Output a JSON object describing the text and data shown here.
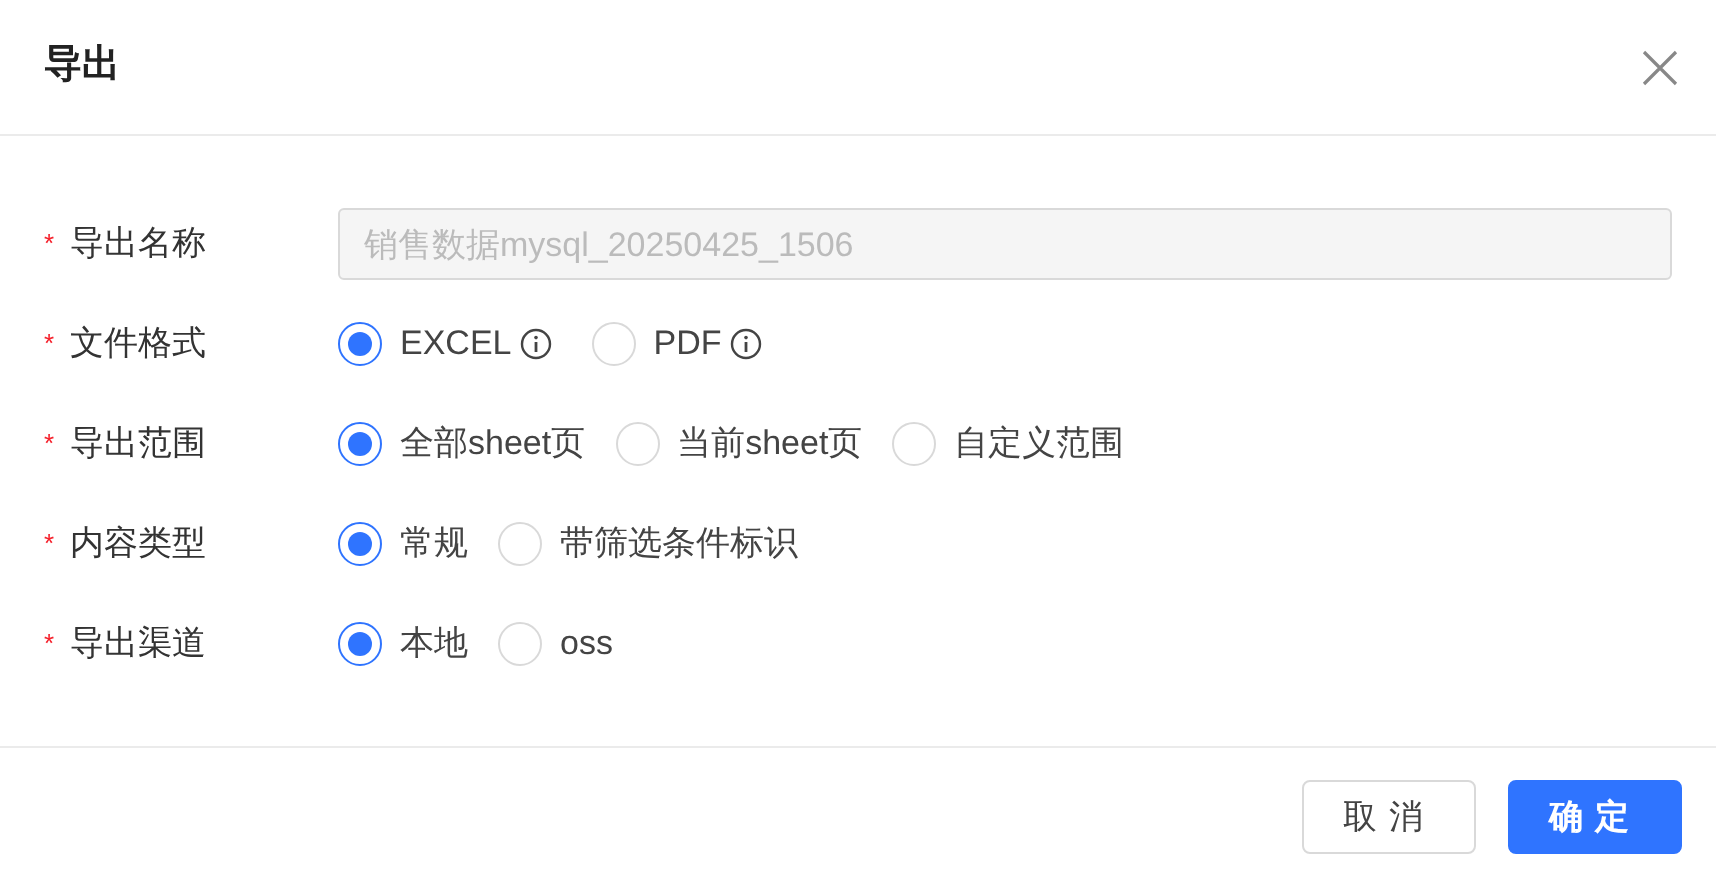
{
  "dialog": {
    "title": "导出"
  },
  "fields": [
    {
      "kind": "text",
      "label": "导出名称",
      "required_mark": "*",
      "value": "销售数据mysql_20250425_1506",
      "disabled": true
    },
    {
      "kind": "radio",
      "label": "文件格式",
      "required_mark": "*",
      "options": [
        {
          "label": "EXCEL",
          "info": true,
          "selected": true
        },
        {
          "label": "PDF",
          "info": true,
          "selected": false
        }
      ]
    },
    {
      "kind": "radio",
      "label": "导出范围",
      "required_mark": "*",
      "options": [
        {
          "label": "全部sheet页",
          "selected": true
        },
        {
          "label": "当前sheet页",
          "selected": false
        },
        {
          "label": "自定义范围",
          "selected": false
        }
      ]
    },
    {
      "kind": "radio",
      "label": "内容类型",
      "required_mark": "*",
      "options": [
        {
          "label": "常规",
          "selected": true
        },
        {
          "label": "带筛选条件标识",
          "selected": false
        }
      ]
    },
    {
      "kind": "radio",
      "label": "导出渠道",
      "required_mark": "*",
      "options": [
        {
          "label": "本地",
          "selected": true
        },
        {
          "label": "oss",
          "selected": false
        }
      ]
    }
  ],
  "buttons": [
    {
      "label": "取消",
      "kind": "default"
    },
    {
      "label": "确定",
      "kind": "primary"
    }
  ]
}
